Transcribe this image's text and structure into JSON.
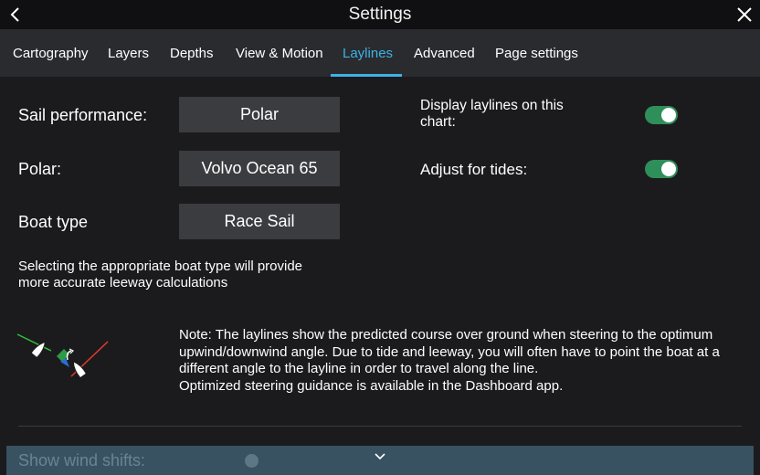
{
  "header": {
    "title": "Settings",
    "back_icon": "chevron-left-icon",
    "close_icon": "close-icon"
  },
  "tabs": [
    {
      "label": "Cartography",
      "active": false
    },
    {
      "label": "Layers",
      "active": false
    },
    {
      "label": "Depths",
      "active": false
    },
    {
      "label": "View & Motion",
      "active": false
    },
    {
      "label": "Laylines",
      "active": true
    },
    {
      "label": "Advanced",
      "active": false
    },
    {
      "label": "Page settings",
      "active": false
    }
  ],
  "settings": {
    "sail_performance": {
      "label": "Sail performance:",
      "value": "Polar"
    },
    "polar": {
      "label": "Polar:",
      "value": "Volvo Ocean 65"
    },
    "boat_type": {
      "label": "Boat type",
      "value": "Race Sail"
    },
    "boat_type_help": "Selecting the appropriate boat type will provide more accurate leeway calculations",
    "display_laylines": {
      "label": "Display laylines on this chart:",
      "enabled": true
    },
    "adjust_tides": {
      "label": "Adjust for tides:",
      "enabled": true
    }
  },
  "note": {
    "illustration_icon": "laylines-diagram-icon",
    "lines": [
      "Note:  The laylines show the predicted course over ground when steering to the optimum",
      "upwind/downwind angle. Due to tide and leeway, you will often have to point the boat at a",
      "different angle to the layline in order to travel along the line.",
      "Optimized steering guidance is available in the Dashboard app."
    ]
  },
  "footer": {
    "partial_label": "Show wind shifts:",
    "expand_icon": "chevron-down-icon"
  },
  "colors": {
    "accent": "#3cb3e6",
    "toggle_on": "#2f8f5a",
    "button_bg": "#3b3c40",
    "tabbar_bg": "#2a2b2f",
    "background": "#1b1b1d"
  }
}
